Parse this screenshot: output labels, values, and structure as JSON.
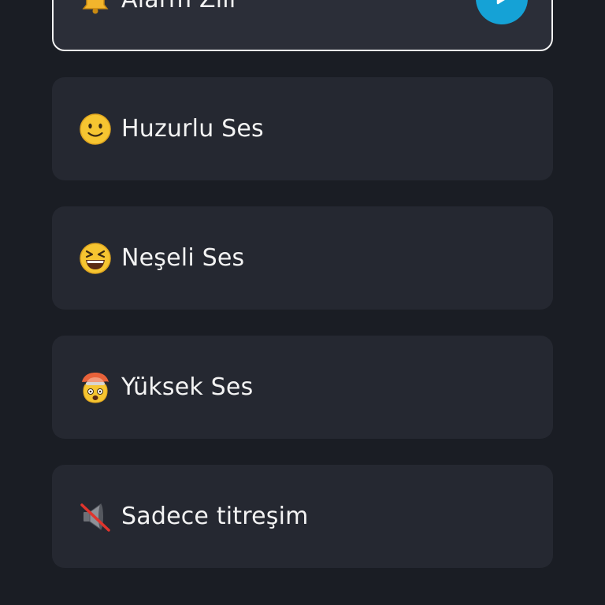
{
  "sounds": [
    {
      "icon": "bell-icon",
      "label": "Alarm Zili",
      "selected": true
    },
    {
      "icon": "slightly-smiling-face-icon",
      "label": "Huzurlu Ses",
      "selected": false
    },
    {
      "icon": "grinning-squinting-face-icon",
      "label": "Neşeli Ses",
      "selected": false
    },
    {
      "icon": "exploding-head-icon",
      "label": "Yüksek Ses",
      "selected": false
    },
    {
      "icon": "muted-speaker-icon",
      "label": "Sadece titreşim",
      "selected": false
    }
  ],
  "play_button": {
    "icon": "play-icon"
  },
  "colors": {
    "background": "#1a1d24",
    "card": "#252831",
    "selected_border": "#f2f2f2",
    "accent": "#15a2d6"
  }
}
